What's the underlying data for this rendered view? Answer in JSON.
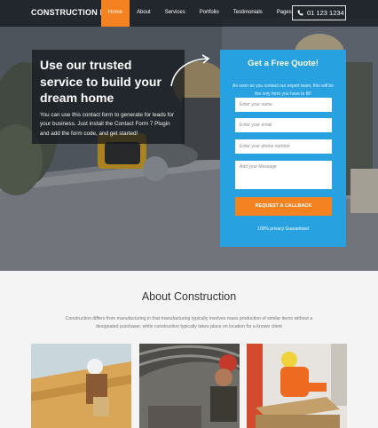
{
  "nav": {
    "logo": "CONSTRUCTION PRO",
    "items": [
      {
        "label": "Home",
        "active": true
      },
      {
        "label": "About",
        "active": false
      },
      {
        "label": "Services",
        "active": false
      },
      {
        "label": "Portfolio",
        "active": false
      },
      {
        "label": "Testimonials",
        "active": false
      },
      {
        "label": "Pages",
        "active": false
      }
    ],
    "phone": "01 123 1234",
    "phone_icon": "phone-icon"
  },
  "hero": {
    "headline": "Use our trusted service to build your dream home",
    "text": "You can use this contact form to generate for leads for your business. Just install the Contact Form 7 Plugin and add the form code, and get started!"
  },
  "quote_form": {
    "title": "Get a Free Quote!",
    "intro": "As soon as you contact our expert team, this will be the only form you have to fill!",
    "name_placeholder": "Enter your name",
    "email_placeholder": "Enter your email",
    "phone_placeholder": "Enter your phone number",
    "message_placeholder": "Add your Message",
    "button": "REQUEST A CALLBACK",
    "privacy": "100% privacy Guaranteed"
  },
  "about": {
    "title": "About Construction",
    "text": "Construction differs from manufacturing in that manufacturing typically involves mass production of similar items without a designated purchaser, while construction typically takes place on location for a known client"
  },
  "colors": {
    "accent": "#f58220",
    "form_blue": "#27a1e0",
    "nav_bg": "#1b1f25"
  }
}
